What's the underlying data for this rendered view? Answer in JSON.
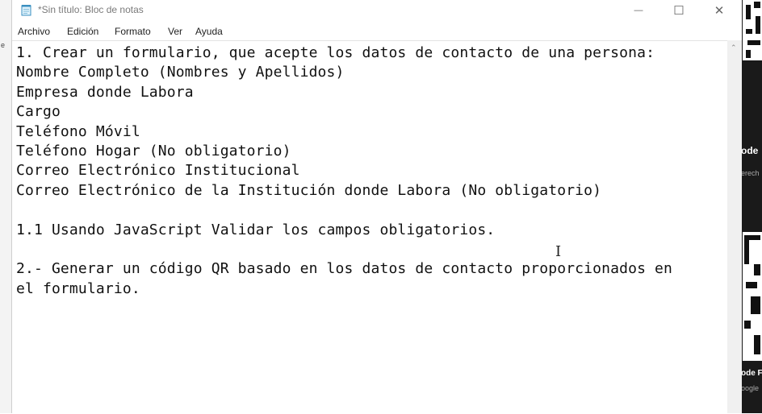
{
  "window": {
    "title": "*Sin título: Bloc de notas",
    "minimize_glyph": "—",
    "maximize_glyph": "☐",
    "close_glyph": "✕"
  },
  "menu": {
    "items": [
      "Archivo",
      "Edición",
      "Formato",
      "Ver",
      "Ayuda"
    ]
  },
  "editor": {
    "lines": [
      "1. Crear un formulario, que acepte los datos de contacto de una persona:",
      "Nombre Completo (Nombres y Apellidos)",
      "Empresa donde Labora",
      "Cargo",
      "Teléfono Móvil",
      "Teléfono Hogar (No obligatorio)",
      "Correo Electrónico Institucional",
      "Correo Electrónico de la Institución donde Labora (No obligatorio)",
      "",
      "1.1 Usando JavaScript Validar los campos obligatorios.",
      "",
      "2.- Generar un código QR basado en los datos de contacto proporcionados en",
      "el formulario."
    ]
  },
  "background_right": {
    "text1": "ode",
    "text2": "erech",
    "text3": "ode F",
    "text4": "oogle"
  },
  "background_left": {
    "mark": "e"
  },
  "colors": {
    "title_text": "#7a7a7a",
    "editor_text": "#111111",
    "right_strip": "#1a1a1a"
  },
  "icons": {
    "app": "notepad-icon",
    "minimize": "minimize-icon",
    "maximize": "maximize-icon",
    "close": "close-icon",
    "scroll_up": "scroll-up-arrow-icon",
    "text_cursor": "ibeam-cursor-icon"
  }
}
